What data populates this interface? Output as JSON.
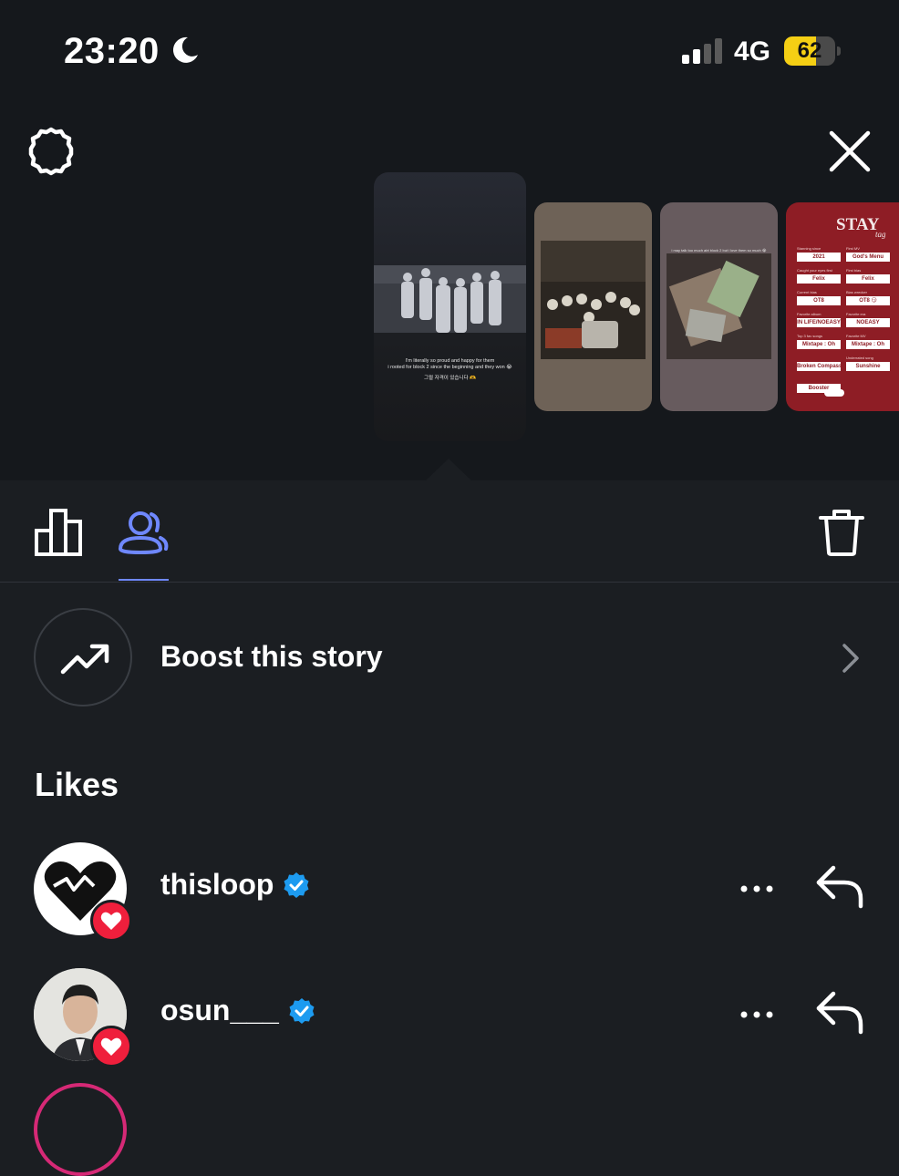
{
  "status_bar": {
    "time": "23:20",
    "network": "4G",
    "battery_percent": "62",
    "battery_level": 0.62
  },
  "stories": {
    "main_caption_line1": "I'm literally so proud and happy for them",
    "main_caption_line2": "i rooted for block 2 since the beginning and they won 😭",
    "main_caption_korean": "그럴 자격이 있습니다 🫶",
    "t3_caption": "i may talk too much abt block 2 but i love them so much 😭",
    "tag": {
      "title": "STAY",
      "subtitle": "tag",
      "fields": [
        {
          "label": "Stanning since",
          "value": "2021"
        },
        {
          "label": "First MV",
          "value": "God's Menu"
        },
        {
          "label": "Caught your eyes first",
          "value": "Felix"
        },
        {
          "label": "First bias",
          "value": "Felix"
        },
        {
          "label": "Current bias",
          "value": "OT8"
        },
        {
          "label": "Bias wrecker",
          "value": "OT8 😏"
        },
        {
          "label": "Favorite album",
          "value": "IN LIFE/NOEASY"
        },
        {
          "label": "Favorite era",
          "value": "NOEASY"
        },
        {
          "label": "Top 3 fav songs",
          "value": "Mixtape : Oh"
        },
        {
          "label": "Favorite MV",
          "value": "Mixtape : Oh"
        },
        {
          "label": "",
          "value": "Broken Compass"
        },
        {
          "label": "Underrated song",
          "value": "Sunshine"
        },
        {
          "label": "",
          "value": "Booster"
        }
      ]
    }
  },
  "icons": {
    "settings": "settings-gear-icon",
    "close": "close-icon",
    "stats": "bar-chart-icon",
    "viewers": "viewers-icon",
    "delete": "trash-icon",
    "boost": "trending-up-icon",
    "chevron": "chevron-right-icon",
    "more": "more-dots-icon",
    "reply": "reply-arrow-icon",
    "heart": "heart-icon",
    "verified": "verified-badge-icon"
  },
  "colors": {
    "tab_active": "#6f88ff",
    "heart_badge": "#ef1f3c",
    "verified": "#1d9bf0",
    "battery": "#f5cf14"
  },
  "boost": {
    "label": "Boost this story"
  },
  "likes": {
    "heading": "Likes",
    "users": [
      {
        "username": "thisloop",
        "verified": true
      },
      {
        "username": "osun___",
        "verified": true
      }
    ]
  }
}
